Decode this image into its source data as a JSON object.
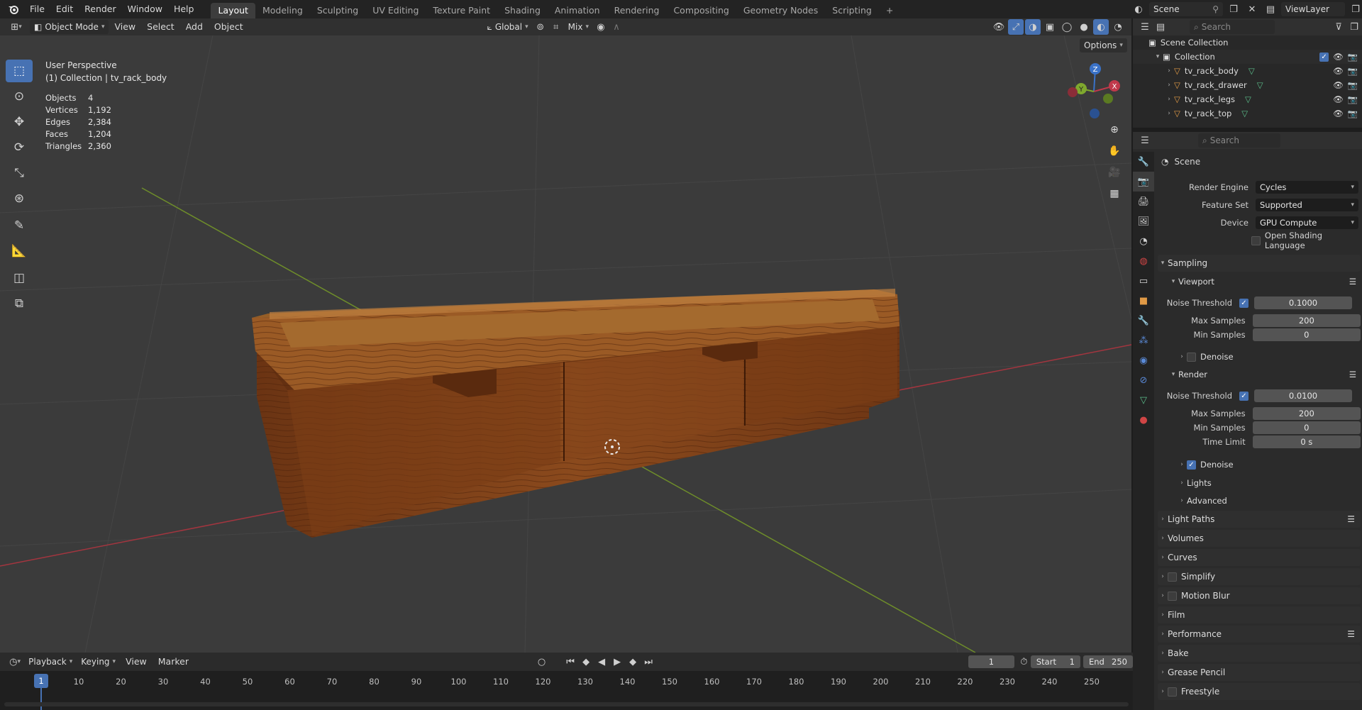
{
  "topbar": {
    "menus": [
      "File",
      "Edit",
      "Render",
      "Window",
      "Help"
    ],
    "workspaces": [
      "Layout",
      "Modeling",
      "Sculpting",
      "UV Editing",
      "Texture Paint",
      "Shading",
      "Animation",
      "Rendering",
      "Compositing",
      "Geometry Nodes",
      "Scripting"
    ],
    "active_workspace": "Layout",
    "add_tab": "+",
    "scene_name": "Scene",
    "view_layer": "ViewLayer"
  },
  "viewport_header": {
    "mode": "Object Mode",
    "menus": [
      "View",
      "Select",
      "Add",
      "Object"
    ],
    "transform_orientation": "Global",
    "snap_blend": "Mix",
    "options": "Options"
  },
  "overlay": {
    "view_name": "User Perspective",
    "collection_line": "(1) Collection | tv_rack_body",
    "stats": [
      {
        "label": "Objects",
        "value": "4"
      },
      {
        "label": "Vertices",
        "value": "1,192"
      },
      {
        "label": "Edges",
        "value": "2,384"
      },
      {
        "label": "Faces",
        "value": "1,204"
      },
      {
        "label": "Triangles",
        "value": "2,360"
      }
    ]
  },
  "gizmo_axes": [
    "Z",
    "Y",
    "X"
  ],
  "outliner": {
    "search_placeholder": "Search",
    "scene_collection": "Scene Collection",
    "collection": "Collection",
    "objects": [
      "tv_rack_body",
      "tv_rack_drawer",
      "tv_rack_legs",
      "tv_rack_top"
    ]
  },
  "properties": {
    "search_placeholder": "Search",
    "context": "Scene",
    "render_engine_label": "Render Engine",
    "render_engine": "Cycles",
    "feature_set_label": "Feature Set",
    "feature_set": "Supported",
    "device_label": "Device",
    "device": "GPU Compute",
    "osl_label": "Open Shading Language",
    "sampling": "Sampling",
    "viewport": "Viewport",
    "noise_threshold_label": "Noise Threshold",
    "viewport_noise_threshold": "0.1000",
    "max_samples_label": "Max Samples",
    "viewport_max_samples": "200",
    "min_samples_label": "Min Samples",
    "viewport_min_samples": "0",
    "denoise_label": "Denoise",
    "render": "Render",
    "render_noise_threshold": "0.0100",
    "render_max_samples": "200",
    "render_min_samples": "0",
    "time_limit_label": "Time Limit",
    "time_limit": "0 s",
    "lights": "Lights",
    "advanced": "Advanced",
    "panels": [
      "Light Paths",
      "Volumes",
      "Curves",
      "Simplify",
      "Motion Blur",
      "Film",
      "Performance",
      "Bake",
      "Grease Pencil",
      "Freestyle"
    ]
  },
  "timeline": {
    "menus": [
      "Playback",
      "Keying",
      "View",
      "Marker"
    ],
    "current_frame": "1",
    "start_label": "Start",
    "start": "1",
    "end_label": "End",
    "end": "250",
    "ticks": [
      "1",
      "10",
      "20",
      "30",
      "40",
      "50",
      "60",
      "70",
      "80",
      "90",
      "100",
      "110",
      "120",
      "130",
      "140",
      "150",
      "160",
      "170",
      "180",
      "190",
      "200",
      "210",
      "220",
      "230",
      "240",
      "250"
    ]
  },
  "colors": {
    "accent": "#4772b3",
    "wood": "#8a4a1e",
    "x_axis": "#c0394b",
    "y_axis": "#7fa82e"
  }
}
